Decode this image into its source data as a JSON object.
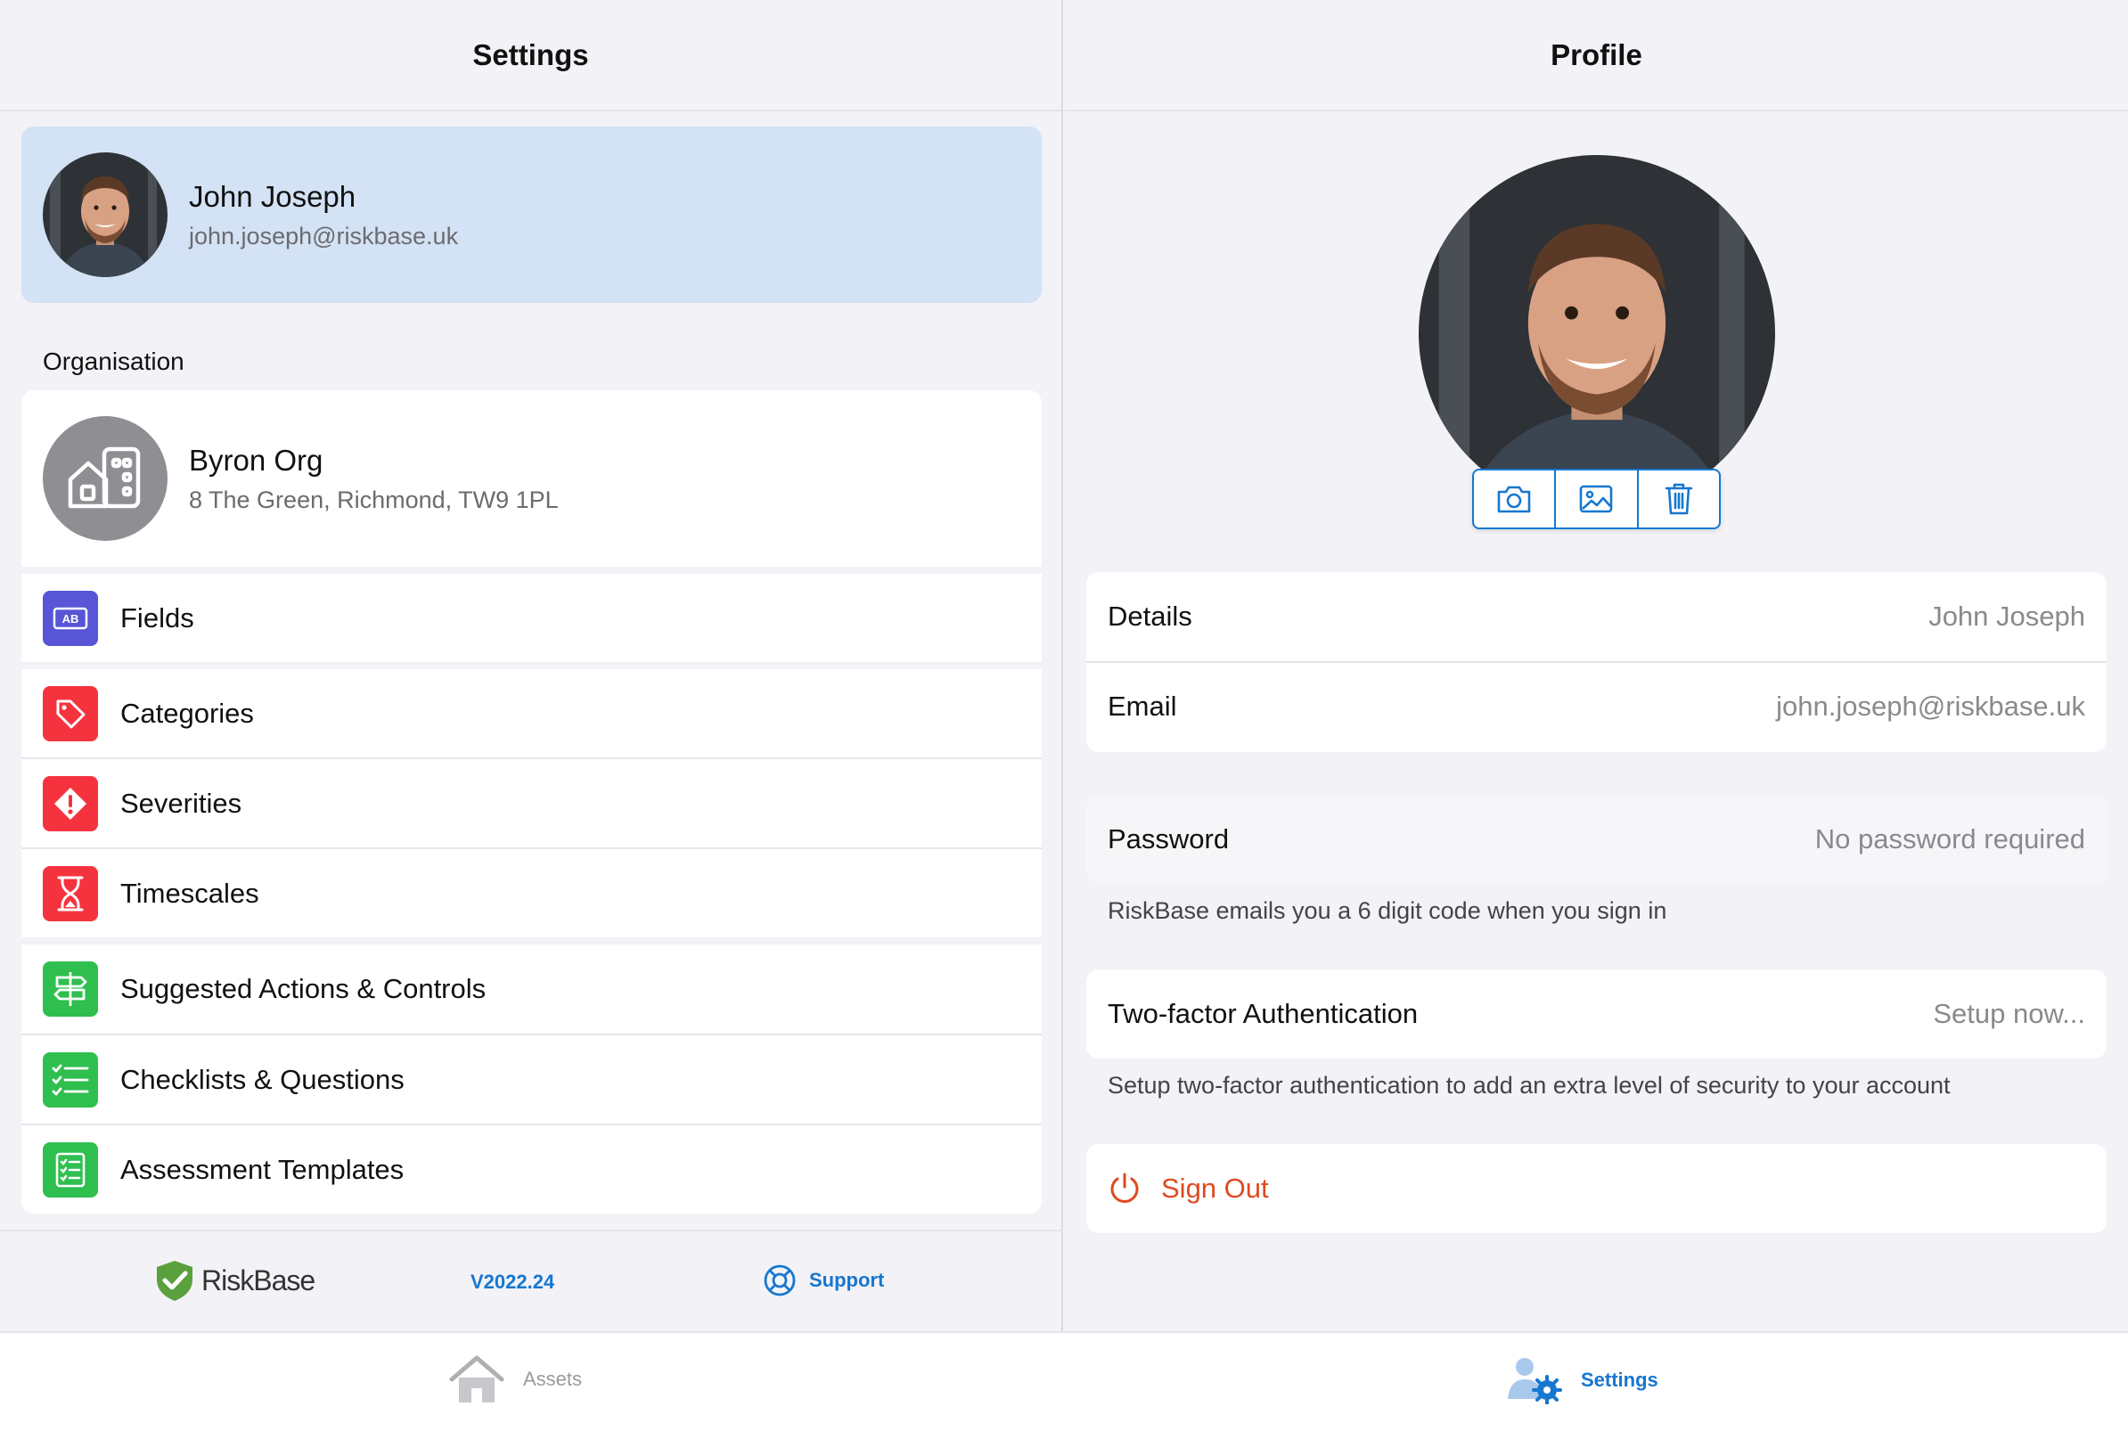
{
  "settings": {
    "title": "Settings",
    "user": {
      "name": "John Joseph",
      "email": "john.joseph@riskbase.uk"
    },
    "organisation_label": "Organisation",
    "org": {
      "name": "Byron Org",
      "address": "8 The Green, Richmond, TW9 1PL"
    },
    "items": [
      {
        "label": "Fields",
        "icon": "fields-icon",
        "color": "#5856d6"
      },
      {
        "label": "Categories",
        "icon": "tag-icon",
        "color": "#f5333f"
      },
      {
        "label": "Severities",
        "icon": "warning-icon",
        "color": "#f5333f"
      },
      {
        "label": "Timescales",
        "icon": "hourglass-icon",
        "color": "#f5333f"
      },
      {
        "label": "Suggested Actions & Controls",
        "icon": "signpost-icon",
        "color": "#2fbf4f"
      },
      {
        "label": "Checklists & Questions",
        "icon": "checklist-icon",
        "color": "#2fbf4f"
      },
      {
        "label": "Assessment Templates",
        "icon": "template-icon",
        "color": "#2fbf4f"
      }
    ],
    "footer": {
      "brand": "RiskBase",
      "version": "V2022.24",
      "support": "Support"
    }
  },
  "profile": {
    "title": "Profile",
    "details_label": "Details",
    "details_value": "John Joseph",
    "email_label": "Email",
    "email_value": "john.joseph@riskbase.uk",
    "password_label": "Password",
    "password_value": "No password required",
    "password_help": "RiskBase emails you a 6 digit code when you sign in",
    "twofa_label": "Two-factor Authentication",
    "twofa_value": "Setup now...",
    "twofa_help": "Setup two-factor authentication to add an extra level of security to your account",
    "signout": "Sign Out"
  },
  "tabbar": {
    "assets": "Assets",
    "settings": "Settings"
  },
  "colors": {
    "accent": "#1677cf",
    "selected_card": "#d3e2f4",
    "destructive": "#e0491f"
  }
}
